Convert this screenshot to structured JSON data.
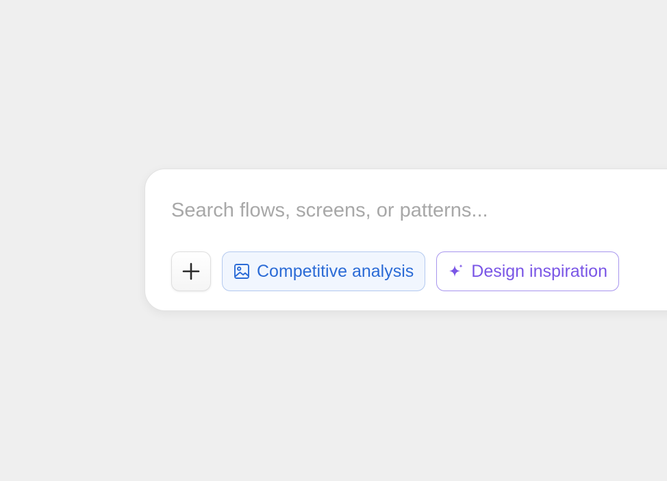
{
  "search": {
    "placeholder": "Search flows, screens, or patterns...",
    "value": ""
  },
  "actions": {
    "add_icon": "plus-icon",
    "chips": [
      {
        "label": "Competitive analysis",
        "icon": "image-icon",
        "color": "#2b6bd6",
        "border": "#b3c9ef",
        "background": "#f1f6fe"
      },
      {
        "label": "Design inspiration",
        "icon": "sparkle-icon",
        "color": "#7a56e6",
        "border": "#a795ee",
        "background": "#ffffff"
      }
    ]
  },
  "colors": {
    "page_background": "#efefef",
    "card_background": "#ffffff",
    "placeholder_text": "#a8a8a8"
  }
}
